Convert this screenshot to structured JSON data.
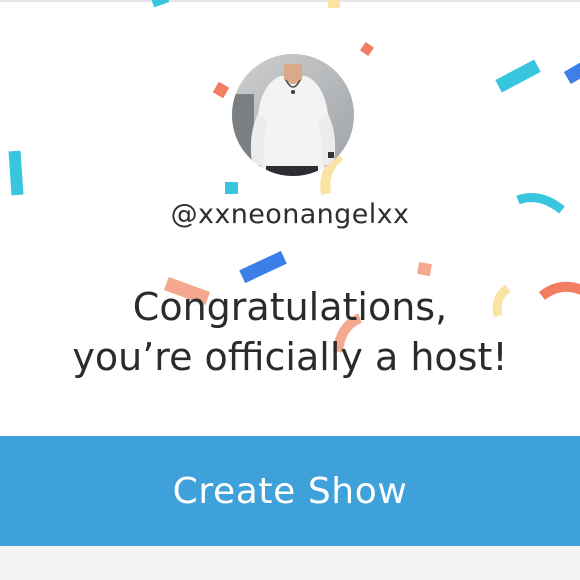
{
  "profile": {
    "username": "@xxneonangelxx"
  },
  "message": {
    "line1": "Congratulations,",
    "line2": "you’re officially a host!"
  },
  "actions": {
    "create_show_label": "Create Show"
  },
  "colors": {
    "primary_button": "#3fa1da",
    "confetti": [
      "#38c6df",
      "#f27d62",
      "#fae3a3",
      "#3d7fe8",
      "#f4a890"
    ]
  }
}
